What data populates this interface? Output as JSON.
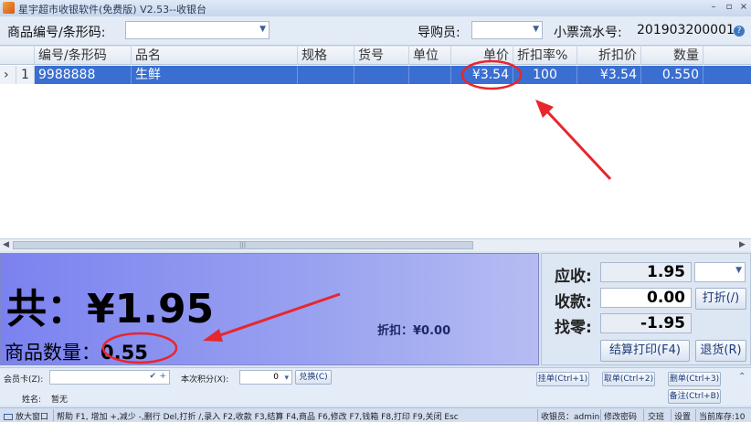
{
  "window": {
    "title": "星宇超市收银软件(免费版) V2.53--收银台",
    "minimize_glyph": "–",
    "restore_glyph": "▫",
    "close_glyph": "×"
  },
  "toolbar": {
    "product_code_label": "商品编号/条形码:",
    "product_code_value": "",
    "guide_label": "导购员:",
    "guide_value": "",
    "receipt_label": "小票流水号:",
    "receipt_number": "201903200001",
    "help_glyph": "?"
  },
  "grid": {
    "columns": [
      "编号/条形码",
      "品名",
      "规格",
      "货号",
      "单位",
      "单价",
      "折扣率%",
      "折扣价",
      "数量"
    ],
    "rows": [
      {
        "row_marker": "›",
        "index": "1",
        "code": "9988888",
        "name": "生鲜",
        "spec": "",
        "item_no": "",
        "unit": "",
        "price": "¥3.54",
        "discount_rate": "100",
        "discount_price": "¥3.54",
        "quantity": "0.550"
      }
    ]
  },
  "summary": {
    "total_text": "共：¥1.95",
    "qty_label": "商品数量：",
    "qty_value": "0.55",
    "discount_text": "折扣：¥0.00"
  },
  "payment": {
    "due_label": "应收:",
    "due_value": "1.95",
    "received_label": "收款:",
    "received_value": "0.00",
    "change_label": "找零:",
    "change_value": "-1.95",
    "discount_button": "打折(/)",
    "checkout_button": "结算打印(F4)",
    "return_button": "退货(R)"
  },
  "member": {
    "card_label": "会员卡(Z):",
    "card_value": "",
    "points_label": "本次积分(X):",
    "points_value": "0",
    "redeem_button": "兑换(C)",
    "name_label": "姓名:",
    "name_value": "暂无",
    "hang_button": "挂单(Ctrl+1)",
    "fetch_button": "取单(Ctrl+2)",
    "delete_button": "删单(Ctrl+3)",
    "note_button": "备注(Ctrl+B)"
  },
  "status": {
    "enlarge_window": "放大窗口",
    "help_text": "帮助 F1, 增加 +,减少 -,删行 Del,打折 /,录入 F2,收款 F3,结算 F4,商品 F6,修改 F7,钱箱 F8,打印 F9,关闭 Esc",
    "cashier": "收银员：admin",
    "change_password": "修改密码",
    "shift": "交班",
    "settings": "设置",
    "stock": "当前库存:10"
  },
  "colors": {
    "selection": "#3a6fd1",
    "panel_gradient_start": "#7b82f0",
    "annotation_red": "#e8262d"
  }
}
